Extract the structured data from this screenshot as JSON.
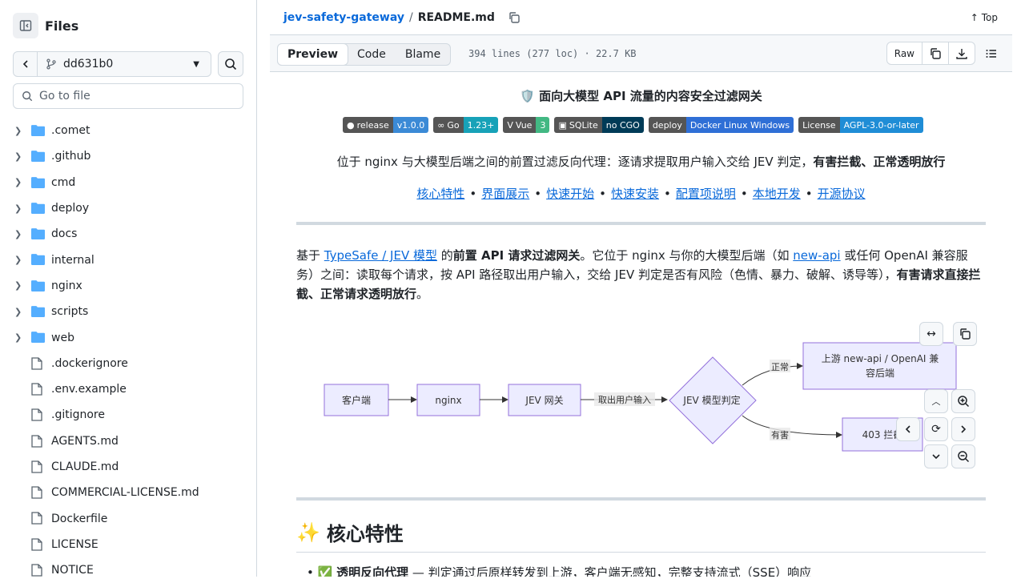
{
  "sidebar": {
    "title": "Files",
    "branch": "dd631b0",
    "goto_placeholder": "Go to file",
    "folders": [
      ".comet",
      ".github",
      "cmd",
      "deploy",
      "docs",
      "internal",
      "nginx",
      "scripts",
      "web"
    ],
    "files": [
      ".dockerignore",
      ".env.example",
      ".gitignore",
      "AGENTS.md",
      "CLAUDE.md",
      "COMMERCIAL-LICENSE.md",
      "Dockerfile",
      "LICENSE",
      "NOTICE"
    ]
  },
  "breadcrumb": {
    "repo": "jev-safety-gateway",
    "sep": "/",
    "file": "README.md"
  },
  "top_label": "Top",
  "tabs": [
    "Preview",
    "Code",
    "Blame"
  ],
  "meta": "394 lines (277 loc) · 22.7 KB",
  "raw_label": "Raw",
  "readme": {
    "title": "面向大模型 API 流量的内容安全过滤网关",
    "badges": [
      {
        "label": "release",
        "value": "v1.0.0",
        "color": "#3b8ad6"
      },
      {
        "label": "Go",
        "value": "1.23+",
        "color": "#17a2b8"
      },
      {
        "label": "Vue",
        "value": "3",
        "color": "#42b883"
      },
      {
        "label": "SQLite",
        "value": "no CGO",
        "color": "#003b57"
      },
      {
        "label": "deploy",
        "value": "Docker Linux Windows",
        "color": "#2f6fd6"
      },
      {
        "label": "License",
        "value": "AGPL-3.0-or-later",
        "color": "#1f8dd6"
      }
    ],
    "lead_a": "位于 nginx 与大模型后端之间的前置过滤反向代理：逐请求提取用户输入交给 JEV 判定，",
    "lead_b": "有害拦截、正常透明放行",
    "nav": [
      "核心特性",
      "界面展示",
      "快速开始",
      "快速安装",
      "配置项说明",
      "本地开发",
      "开源协议"
    ],
    "nav_sep": "•",
    "p_1": "基于 ",
    "p_link1": "TypeSafe / JEV 模型",
    "p_2": " 的",
    "p_bold1": "前置 API 请求过滤网关",
    "p_3": "。它位于 nginx 与你的大模型后端（如 ",
    "p_link2": "new-api",
    "p_4": " 或任何 OpenAI 兼容服务）之间：读取每个请求，按 API 路径取出用户输入，交给 JEV 判定是否有风险（色情、暴力、破解、诱导等），",
    "p_bold2": "有害请求直接拦截、正常请求透明放行",
    "p_5": "。",
    "diagram": {
      "client": "客户端",
      "nginx": "nginx",
      "gateway": "JEV 网关",
      "edge_extract": "取出用户输入",
      "judge": "JEV 模型判定",
      "edge_ok": "正常",
      "upstream_1": "上游 new-api / OpenAI 兼",
      "upstream_2": "容后端",
      "edge_bad": "有害",
      "blocked": "403 拦截"
    },
    "h2_emoji": "✨",
    "h2": "核心特性",
    "li_emoji": "✅",
    "li_bold": "透明反向代理",
    "li_text": " — 判定通过后原样转发到上游，客户端无感知，完整支持流式（SSE）响应"
  }
}
